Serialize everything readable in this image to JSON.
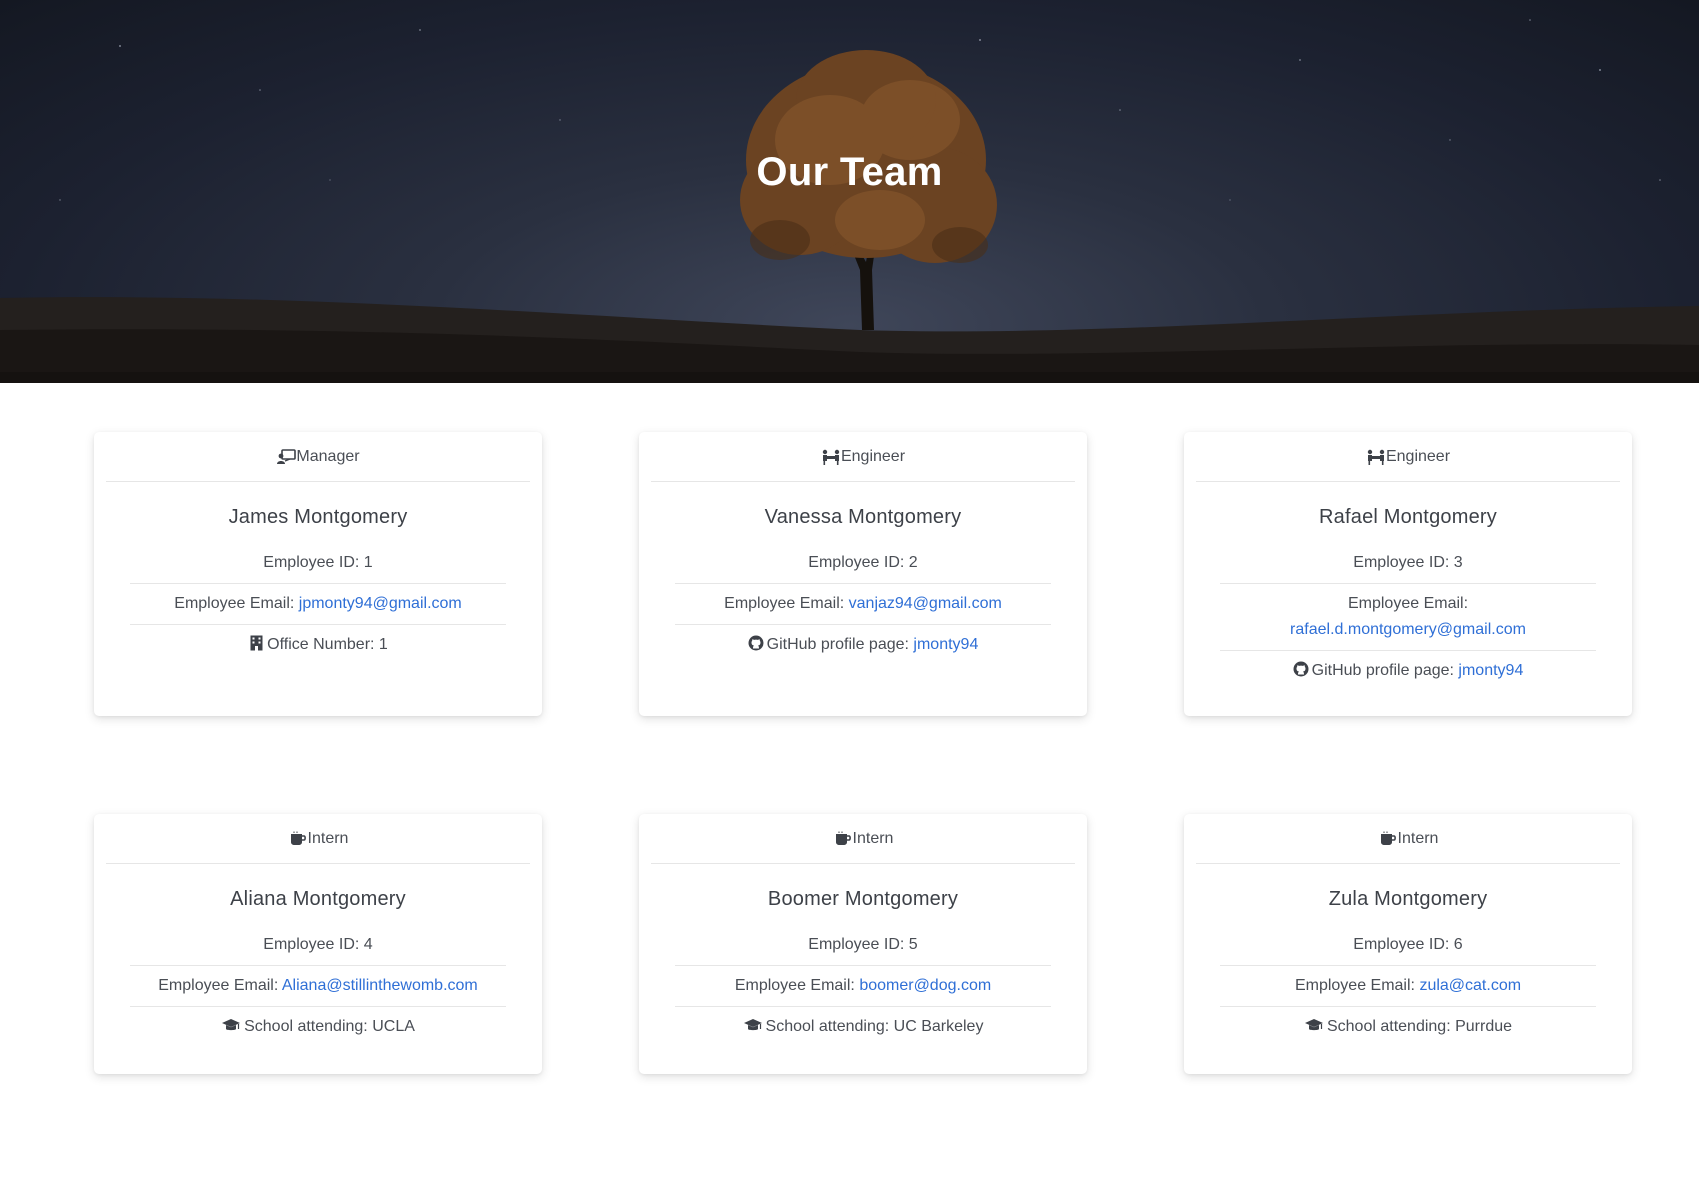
{
  "hero": {
    "title": "Our Team"
  },
  "labels": {
    "id": "Employee ID:",
    "email": "Employee Email:",
    "office": "Office Number:",
    "github": "GitHub profile page:",
    "school": "School attending:"
  },
  "colors": {
    "link": "#2f6fd6",
    "text": "#3d4148",
    "divider": "#e6e6e6"
  },
  "cards": [
    {
      "role": "Manager",
      "role_icon": "manager-icon",
      "name": "James Montgomery",
      "id": "1",
      "email": "jpmonty94@gmail.com",
      "office": "1",
      "extra_icon": "building-icon"
    },
    {
      "role": "Engineer",
      "role_icon": "engineer-icon",
      "name": "Vanessa Montgomery",
      "id": "2",
      "email": "vanjaz94@gmail.com",
      "github": "jmonty94",
      "extra_icon": "github-icon"
    },
    {
      "role": "Engineer",
      "role_icon": "engineer-icon",
      "name": "Rafael Montgomery",
      "id": "3",
      "email": "rafael.d.montgomery@gmail.com",
      "github": "jmonty94",
      "extra_icon": "github-icon"
    },
    {
      "role": "Intern",
      "role_icon": "mug-icon",
      "name": "Aliana Montgomery",
      "id": "4",
      "email": "Aliana@stillinthewomb.com",
      "school": "UCLA",
      "extra_icon": "graduation-cap-icon"
    },
    {
      "role": "Intern",
      "role_icon": "mug-icon",
      "name": "Boomer Montgomery",
      "id": "5",
      "email": "boomer@dog.com",
      "school": "UC Barkeley",
      "extra_icon": "graduation-cap-icon"
    },
    {
      "role": "Intern",
      "role_icon": "mug-icon",
      "name": "Zula Montgomery",
      "id": "6",
      "email": "zula@cat.com",
      "school": "Purrdue",
      "extra_icon": "graduation-cap-icon"
    }
  ]
}
